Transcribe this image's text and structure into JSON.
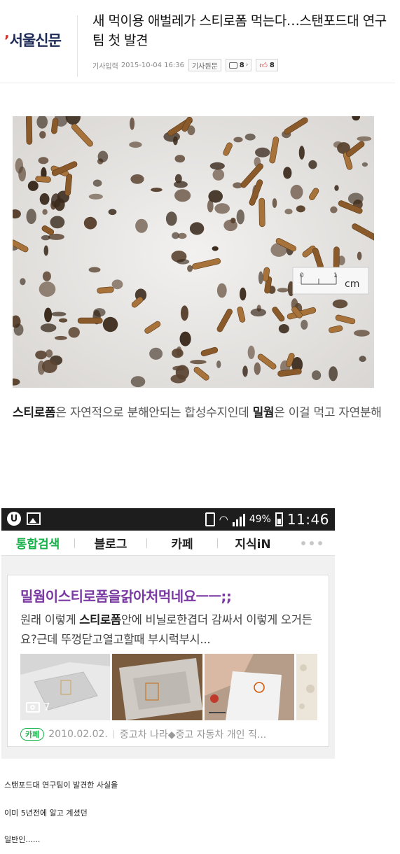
{
  "article": {
    "publisher": "서울신문",
    "headline": "새 먹이용 애벌레가 스티로폼 먹는다…스탠포드대 연구팀 첫 발견",
    "meta_label": "기사입력",
    "datetime": "2015-10-04 16:36",
    "original_label": "기사원문",
    "comment_count": "8",
    "like_count": "8"
  },
  "photo": {
    "scale_label": "cm",
    "scale_tick_start": "0",
    "scale_tick_end": "1"
  },
  "caption": {
    "bold1": "스티로폼",
    "text1": "은 자연적으로 분해안되는 합성수지인데 ",
    "bold2": "밀웜",
    "text2": "은 이걸 먹고 자연분해"
  },
  "phone": {
    "battery": "49%",
    "time": "11:46",
    "tabs": [
      "통합검색",
      "블로그",
      "카페",
      "지식iN"
    ],
    "result": {
      "title": "밀웜이스티로폼을갉아처먹네요ㅡㅡ;;",
      "snippet_a": "원래 이렇게 ",
      "snippet_bold": "스티로폼",
      "snippet_b": "안에 비닐로한겹더 감싸서 이렇게 오거든요?근데 뚜껑닫고열고할때 부시럭부시...",
      "image_count": "7",
      "badge": "카페",
      "date": "2010.02.02.",
      "source": "중고차 나라◆중고 자동차 개인 직..."
    }
  },
  "notes": [
    "스탠포드대 연구팀이 발견한 사실을",
    "이미 5년전에 알고 계셨던",
    "일반인......"
  ],
  "colors": {
    "naver_green": "#17b24a",
    "result_title_purple": "#7b3aa3",
    "status_bar": "#1d1d1d"
  }
}
